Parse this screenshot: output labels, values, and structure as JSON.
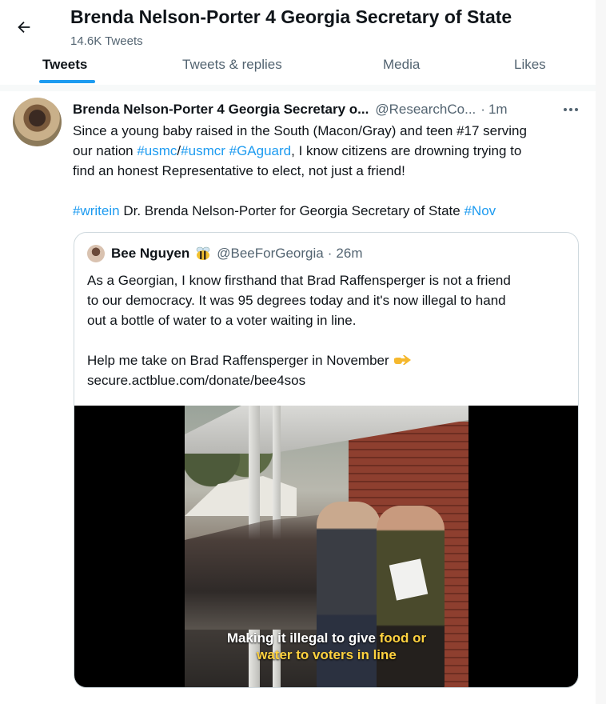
{
  "header": {
    "title": "Brenda Nelson-Porter 4 Georgia Secretary of State",
    "tweet_count": "14.6K Tweets"
  },
  "tabs": [
    {
      "label": "Tweets",
      "active": true
    },
    {
      "label": "Tweets & replies",
      "active": false
    },
    {
      "label": "Media",
      "active": false
    },
    {
      "label": "Likes",
      "active": false
    }
  ],
  "tweet": {
    "author_name": "Brenda Nelson-Porter 4 Georgia Secretary o...",
    "handle": "@ResearchCo...",
    "separator": "·",
    "time": "1m",
    "line1": "Since a young baby raised in the South (Macon/Gray) and teen #17 serving",
    "line2_pre": "our nation ",
    "tag_usmc": "#usmc",
    "slash": "/",
    "tag_usmcr": "#usmcr",
    "space": " ",
    "tag_gaguard": "#GAguard",
    "line2_post": ", I know citizens are drowning trying to",
    "line3": "find an honest Representative to elect, not just a friend!",
    "tag_writein": "#writein",
    "line5_mid": " Dr. Brenda Nelson-Porter for Georgia Secretary of State ",
    "tag_nov": "#Nov"
  },
  "quote": {
    "name": "Bee Nguyen",
    "handle": "@BeeForGeorgia",
    "separator": "·",
    "time": "26m",
    "line1": "As a Georgian, I know firsthand that Brad Raffensperger is not a friend",
    "line2": "to our democracy. It was 95 degrees today and it's now illegal to hand",
    "line3": "out a bottle of water to a voter waiting in line.",
    "line5": "Help me take on Brad Raffensperger in November",
    "line6": "secure.actblue.com/donate/bee4sos",
    "emoji_after_name": "bee-icon",
    "emoji_after_text": "pointing-right-icon"
  },
  "video": {
    "caption_white1": "Making it illegal to give ",
    "caption_yellow1": "food or",
    "caption_yellow2": "water to voters in line"
  },
  "colors": {
    "accent": "#1d9bf0",
    "text": "#0f1419",
    "muted": "#536471",
    "border": "#cfd9de"
  }
}
